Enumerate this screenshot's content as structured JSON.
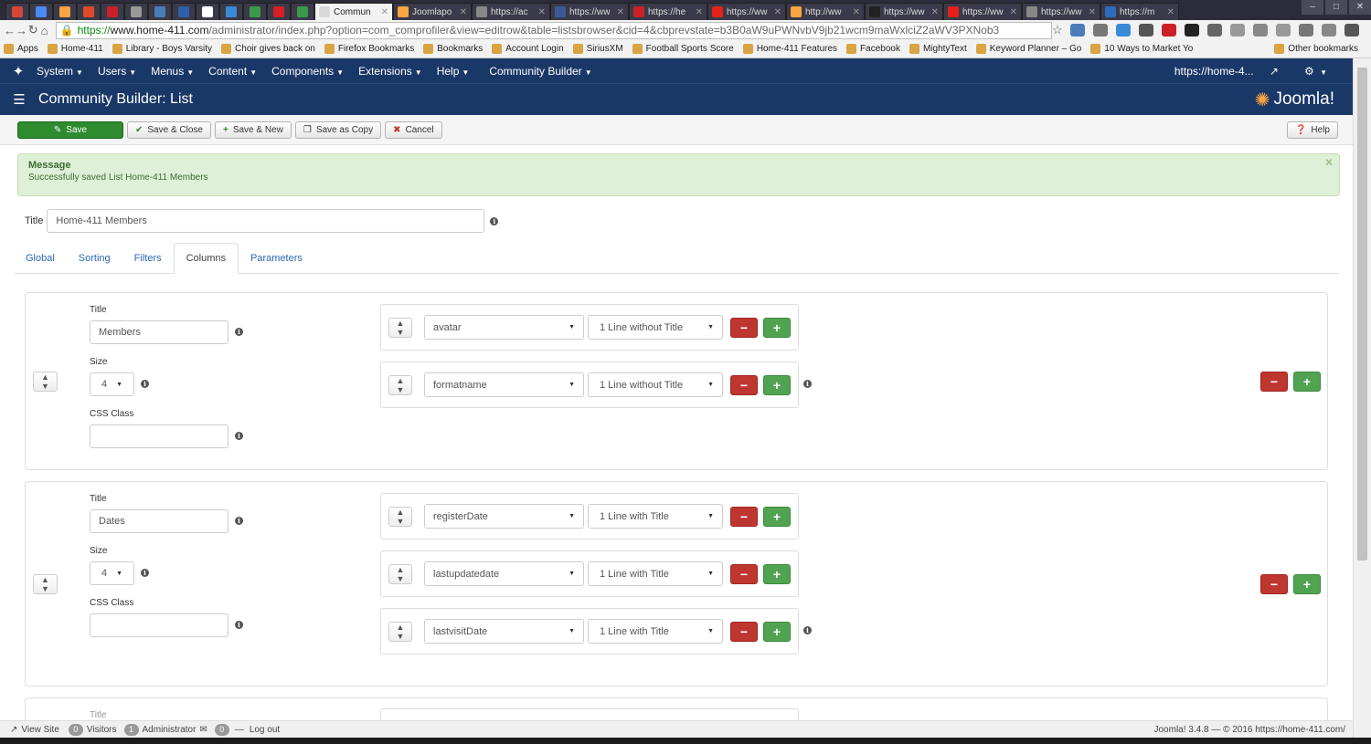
{
  "browser": {
    "tabs": [
      {
        "label": "",
        "color": "#d44638",
        "small": true
      },
      {
        "label": "",
        "color": "#4a8af4",
        "small": true
      },
      {
        "label": "",
        "color": "#f9a541",
        "small": true
      },
      {
        "label": "",
        "color": "#e04a2a",
        "small": true
      },
      {
        "label": "",
        "color": "#cb2027",
        "small": true
      },
      {
        "label": "",
        "color": "#999999",
        "small": true
      },
      {
        "label": "",
        "color": "#4a7db8",
        "small": true
      },
      {
        "label": "",
        "color": "#2e5fa8",
        "small": true
      },
      {
        "label": "",
        "color": "#ffffff",
        "small": true
      },
      {
        "label": "",
        "color": "#3a8ad8",
        "small": true
      },
      {
        "label": "",
        "color": "#3a9a4a",
        "small": true
      },
      {
        "label": "",
        "color": "#d81f26",
        "small": true
      },
      {
        "label": "",
        "color": "#3a9a4a",
        "small": true
      },
      {
        "label": "Commun",
        "color": "#d9d9d9",
        "active": true
      },
      {
        "label": "Joomlapo",
        "color": "#f9a541"
      },
      {
        "label": "https://ac",
        "color": "#888888"
      },
      {
        "label": "https://ww",
        "color": "#3b5998"
      },
      {
        "label": "https://he",
        "color": "#cb2027"
      },
      {
        "label": "https://ww",
        "color": "#e62117"
      },
      {
        "label": "http://ww",
        "color": "#f9a541"
      },
      {
        "label": "https://ww",
        "color": "#222222"
      },
      {
        "label": "https://ww",
        "color": "#e62117"
      },
      {
        "label": "https://ww",
        "color": "#888888"
      },
      {
        "label": "https://m",
        "color": "#2e6bbd"
      }
    ],
    "url": {
      "https": "https://",
      "host": "www.home-411.com",
      "path": "/administrator/index.php?option=com_comprofiler&view=editrow&table=listsbrowser&cid=4&cbprevstate=b3B0aW9uPWNvbV9jb21wcm9maWxlciZ2aWV3PXNob3"
    },
    "bookmarks": [
      "Apps",
      "Home-411",
      "Library - Boys Varsity",
      "Choir gives back on",
      "Firefox Bookmarks",
      "Bookmarks",
      "Account Login",
      "SiriusXM",
      "Football Sports Score",
      "Home-411 Features",
      "Facebook",
      "MightyText",
      "Keyword Planner – Go",
      "10 Ways to Market Yo"
    ],
    "other_bookmarks": "Other bookmarks"
  },
  "topnav": {
    "items": [
      "System",
      "Users",
      "Menus",
      "Content",
      "Components",
      "Extensions",
      "Help"
    ],
    "community_builder": "Community Builder",
    "site_link": "https://home-4..."
  },
  "header": {
    "title": "Community Builder: List",
    "brand": "Joomla!"
  },
  "toolbar": {
    "save": "Save",
    "save_close": "Save & Close",
    "save_new": "Save & New",
    "save_copy": "Save as Copy",
    "cancel": "Cancel",
    "help": "Help"
  },
  "message": {
    "heading": "Message",
    "text": "Successfully saved List Home-411 Members"
  },
  "form": {
    "title_label": "Title",
    "title_value": "Home-411 Members"
  },
  "tabs": {
    "global": "Global",
    "sorting": "Sorting",
    "filters": "Filters",
    "columns": "Columns",
    "parameters": "Parameters"
  },
  "columns": [
    {
      "title_label": "Title",
      "title": "Members",
      "size_label": "Size",
      "size": "4",
      "css_label": "CSS Class",
      "css": "",
      "fields": [
        {
          "field": "avatar",
          "display": "1 Line without Title"
        },
        {
          "field": "formatname",
          "display": "1 Line without Title"
        }
      ]
    },
    {
      "title_label": "Title",
      "title": "Dates",
      "size_label": "Size",
      "size": "4",
      "css_label": "CSS Class",
      "css": "",
      "fields": [
        {
          "field": "registerDate",
          "display": "1 Line with Title"
        },
        {
          "field": "lastupdatedate",
          "display": "1 Line with Title"
        },
        {
          "field": "lastvisitDate",
          "display": "1 Line with Title"
        }
      ]
    }
  ],
  "next_panel_title": "Title",
  "status": {
    "view_site": "View Site",
    "visitors_count": "0",
    "visitors": "Visitors",
    "admin_count": "1",
    "admin": "Administrator",
    "messages_count": "0",
    "logout": "Log out",
    "right": "Joomla! 3.4.8 — © 2016 https://home-411.com/"
  },
  "colors": {
    "nav_bg": "#1a3867",
    "save_green": "#2e8b2e",
    "message_bg": "#dff0d8",
    "remove_red": "#bd362f",
    "add_green": "#51a351",
    "tab_link": "#2a69b8"
  }
}
